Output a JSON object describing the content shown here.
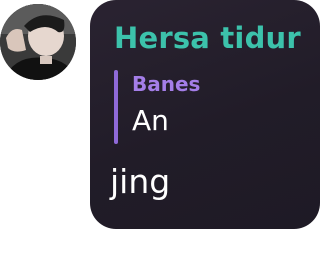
{
  "message": {
    "sender_name": "Hersa tidur",
    "reply": {
      "author": "Banes",
      "text": "An"
    },
    "text": "jing"
  },
  "colors": {
    "sender_name": "#3cc2ab",
    "reply_accent": "#8f6ad8",
    "reply_author": "#a47ee8",
    "bubble_background": "#231e2a",
    "text": "#ffffff"
  },
  "icons": {
    "avatar": "user-photo-avatar"
  }
}
